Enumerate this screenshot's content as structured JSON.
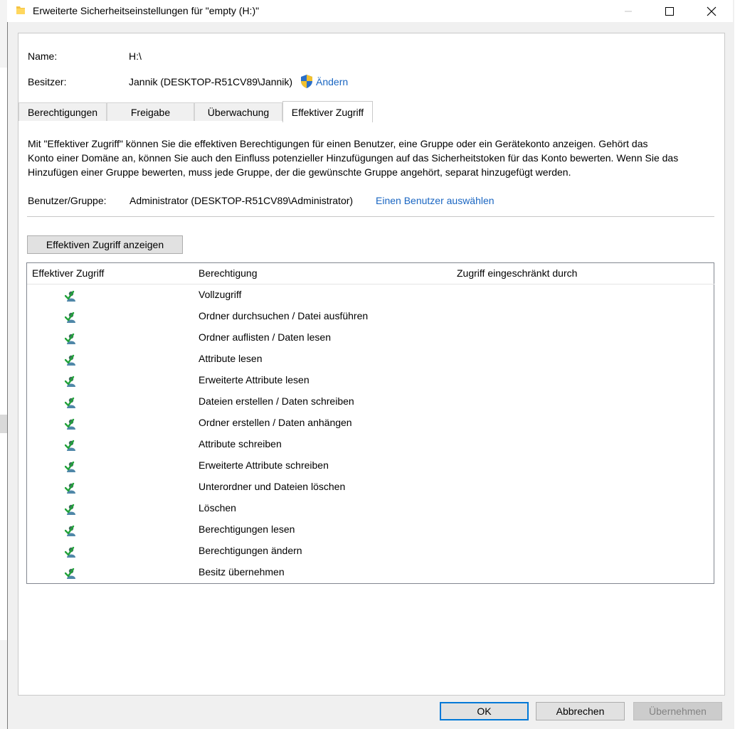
{
  "window": {
    "title": "Erweiterte Sicherheitseinstellungen für \"empty (H:)\""
  },
  "info": {
    "name_label": "Name:",
    "name_value": "H:\\",
    "owner_label": "Besitzer:",
    "owner_value": "Jannik (DESKTOP-R51CV89\\Jannik)",
    "change_link": "Ändern"
  },
  "tabs": [
    {
      "label": "Berechtigungen"
    },
    {
      "label": "Freigabe"
    },
    {
      "label": "Überwachung"
    },
    {
      "label": "Effektiver Zugriff"
    }
  ],
  "description": {
    "line1": "Mit \"Effektiver Zugriff\" können Sie die effektiven Berechtigungen für einen Benutzer, eine Gruppe oder ein Gerätekonto anzeigen. Gehört das",
    "line2": "Konto einer Domäne an, können Sie auch den Einfluss potenzieller Hinzufügungen auf das Sicherheitstoken für das Konto bewerten. Wenn Sie das",
    "line3": "Hinzufügen einer Gruppe bewerten, muss jede Gruppe, der die gewünschte Gruppe angehört, separat hinzugefügt werden."
  },
  "user": {
    "label": "Benutzer/Gruppe:",
    "value": "Administrator (DESKTOP-R51CV89\\Administrator)",
    "select_link": "Einen Benutzer auswählen"
  },
  "show_button": "Effektiven Zugriff anzeigen",
  "table": {
    "headers": [
      "Effektiver Zugriff",
      "Berechtigung",
      "Zugriff eingeschränkt durch"
    ],
    "rows": [
      {
        "icon": "check-user-icon",
        "permission": "Vollzugriff"
      },
      {
        "icon": "check-user-icon",
        "permission": "Ordner durchsuchen / Datei ausführen"
      },
      {
        "icon": "check-user-icon",
        "permission": "Ordner auflisten / Daten lesen"
      },
      {
        "icon": "check-user-icon",
        "permission": "Attribute lesen"
      },
      {
        "icon": "check-user-icon",
        "permission": "Erweiterte Attribute lesen"
      },
      {
        "icon": "check-user-icon",
        "permission": "Dateien erstellen / Daten schreiben"
      },
      {
        "icon": "check-user-icon",
        "permission": "Ordner erstellen / Daten anhängen"
      },
      {
        "icon": "check-user-icon",
        "permission": "Attribute schreiben"
      },
      {
        "icon": "check-user-icon",
        "permission": "Erweiterte Attribute schreiben"
      },
      {
        "icon": "check-user-icon",
        "permission": "Unterordner und Dateien löschen"
      },
      {
        "icon": "check-user-icon",
        "permission": "Löschen"
      },
      {
        "icon": "check-user-icon",
        "permission": "Berechtigungen lesen"
      },
      {
        "icon": "check-user-icon",
        "permission": "Berechtigungen ändern"
      },
      {
        "icon": "check-user-icon",
        "permission": "Besitz übernehmen"
      }
    ]
  },
  "footer": {
    "ok": "OK",
    "cancel": "Abbrechen",
    "apply": "Übernehmen"
  },
  "colors": {
    "link": "#1a66c2",
    "ok_border": "#0078d7",
    "disabled_text": "#838383"
  }
}
